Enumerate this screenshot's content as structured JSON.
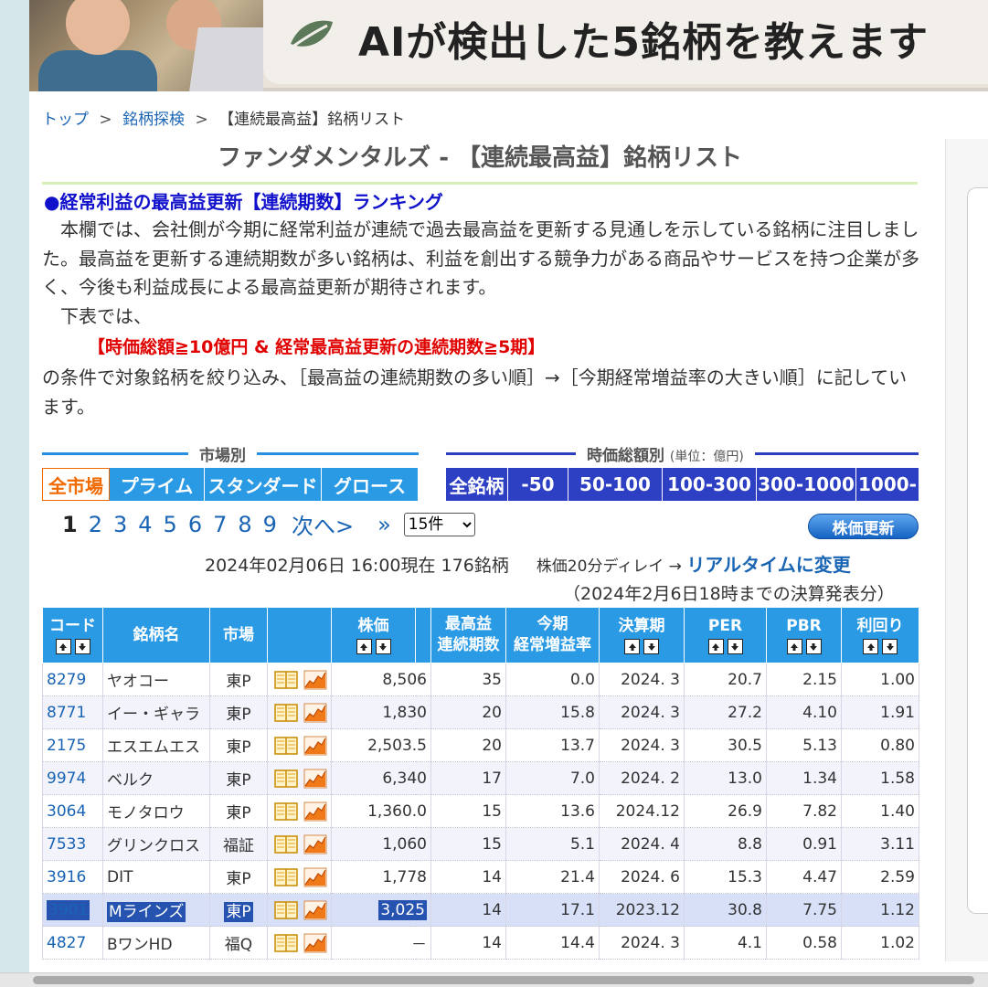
{
  "banner": {
    "title": "AIが検出した5銘柄を教えます"
  },
  "breadcrumb": {
    "top": "トップ",
    "search": "銘柄探検",
    "current": "【連続最高益】銘柄リスト",
    "sep": ">"
  },
  "page_title": "ファンダメンタルズ - 【連続最高益】銘柄リスト",
  "section_heading": "●経常利益の最高益更新【連続期数】ランキング",
  "intro": {
    "p1": "本欄では、会社側が今期に経常利益が連続で過去最高益を更新する見通しを示している銘柄に注目しました。最高益を更新する連続期数が多い銘柄は、利益を創出する競争力がある商品やサービスを持つ企業が多く、今後も利益成長による最高益更新が期待されます。",
    "p2": "下表では、",
    "condition": "【時価総額≧10億円 & 経常最高益更新の連続期数≧5期】",
    "p3": "の条件で対象銘柄を絞り込み、［最高益の連続期数の多い順］→［今期経常増益率の大きい順］に記しています。"
  },
  "filters": {
    "market_label": "市場別",
    "market_tabs": [
      "全市場",
      "プライム",
      "スタンダード",
      "グロース"
    ],
    "cap_label": "時価総額別",
    "cap_unit": "(単位：億円)",
    "cap_tabs": [
      "全銘柄",
      "-50",
      "50-100",
      "100-300",
      "300-1000",
      "1000-"
    ]
  },
  "pager": {
    "pages": [
      "1",
      "2",
      "3",
      "4",
      "5",
      "6",
      "7",
      "8",
      "9"
    ],
    "next": "次へ>",
    "last": "»",
    "per_page": "15件",
    "refresh": "株価更新"
  },
  "status": {
    "datetime": "2024年02月06日 16:00現在 176銘柄",
    "delay": "株価20分ディレイ → ",
    "realtime": "リアルタイムに変更",
    "note": "（2024年2月6日18時までの決算発表分）"
  },
  "table": {
    "headers": {
      "code": "コード",
      "name": "銘柄名",
      "market": "市場",
      "price": "株価",
      "streak_1": "最高益",
      "streak_2": "連続期数",
      "growth_1": "今期",
      "growth_2": "経常増益率",
      "period": "決算期",
      "per": "PER",
      "pbr": "PBR",
      "yield": "利回り"
    },
    "rows": [
      {
        "code": "8279",
        "name": "ヤオコー",
        "market": "東P",
        "price": "8,506",
        "streak": "35",
        "growth": "0.0",
        "period": "2024. 3",
        "per": "20.7",
        "pbr": "2.15",
        "yield": "1.00"
      },
      {
        "code": "8771",
        "name": "イー・ギャラ",
        "market": "東P",
        "price": "1,830",
        "streak": "20",
        "growth": "15.8",
        "period": "2024. 3",
        "per": "27.2",
        "pbr": "4.10",
        "yield": "1.91"
      },
      {
        "code": "2175",
        "name": "エスエムエス",
        "market": "東P",
        "price": "2,503.5",
        "streak": "20",
        "growth": "13.7",
        "period": "2024. 3",
        "per": "30.5",
        "pbr": "5.13",
        "yield": "0.80"
      },
      {
        "code": "9974",
        "name": "ベルク",
        "market": "東P",
        "price": "6,340",
        "streak": "17",
        "growth": "7.0",
        "period": "2024. 2",
        "per": "13.0",
        "pbr": "1.34",
        "yield": "1.58"
      },
      {
        "code": "3064",
        "name": "モノタロウ",
        "market": "東P",
        "price": "1,360.0",
        "streak": "15",
        "growth": "13.6",
        "period": "2024.12",
        "per": "26.9",
        "pbr": "7.82",
        "yield": "1.40"
      },
      {
        "code": "7533",
        "name": "グリンクロス",
        "market": "福証",
        "price": "1,060",
        "streak": "15",
        "growth": "5.1",
        "period": "2024. 4",
        "per": "8.8",
        "pbr": "0.91",
        "yield": "3.11"
      },
      {
        "code": "3916",
        "name": "DIT",
        "market": "東P",
        "price": "1,778",
        "streak": "14",
        "growth": "21.4",
        "period": "2024. 6",
        "per": "15.3",
        "pbr": "4.47",
        "yield": "2.59"
      },
      {
        "code": "3901",
        "name": "Mラインズ",
        "market": "東P",
        "price": "3,025",
        "streak": "14",
        "growth": "17.1",
        "period": "2023.12",
        "per": "30.8",
        "pbr": "7.75",
        "yield": "1.12"
      },
      {
        "code": "4827",
        "name": "BワンHD",
        "market": "福Q",
        "price": "－",
        "streak": "14",
        "growth": "14.4",
        "period": "2024. 3",
        "per": "4.1",
        "pbr": "0.58",
        "yield": "1.02"
      }
    ]
  },
  "colors": {
    "link": "#1a64b4",
    "market_tab": "#2a9ae4",
    "cap_tab": "#2d3fc2",
    "active_tab": "#f06a00",
    "condition": "#e00000",
    "heading": "#1111cc"
  }
}
